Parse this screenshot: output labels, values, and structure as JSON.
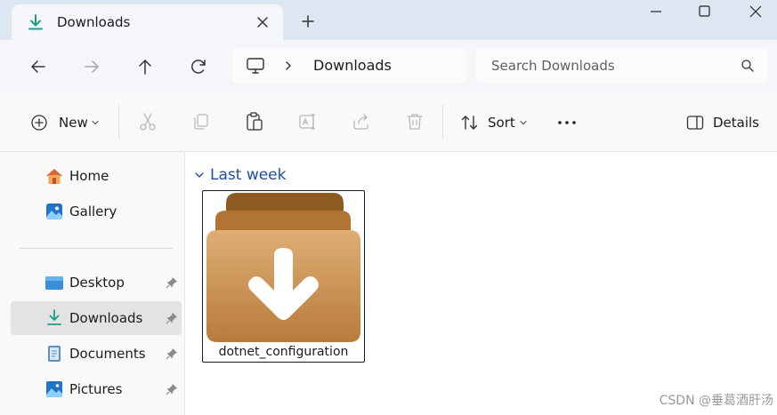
{
  "tab": {
    "title": "Downloads"
  },
  "address": {
    "location": "Downloads"
  },
  "search": {
    "placeholder": "Search Downloads"
  },
  "commands": {
    "new_label": "New",
    "sort_label": "Sort",
    "details_label": "Details"
  },
  "sidebar": {
    "items": [
      {
        "label": "Home",
        "icon": "home-icon"
      },
      {
        "label": "Gallery",
        "icon": "gallery-icon"
      },
      {
        "label": "Desktop",
        "icon": "desktop-icon",
        "pinned": true
      },
      {
        "label": "Downloads",
        "icon": "downloads-icon",
        "pinned": true,
        "selected": true
      },
      {
        "label": "Documents",
        "icon": "documents-icon",
        "pinned": true
      },
      {
        "label": "Pictures",
        "icon": "pictures-icon",
        "pinned": true
      }
    ]
  },
  "content": {
    "group_label": "Last week",
    "files": [
      {
        "name": "dotnet_configuration",
        "icon": "downloads-folder-icon"
      }
    ]
  },
  "watermark": "CSDN @垂葛酒肝汤",
  "colors": {
    "accent": "#1f4fa0",
    "download_green": "#2a9d8f",
    "folder": "#c68a4c"
  }
}
